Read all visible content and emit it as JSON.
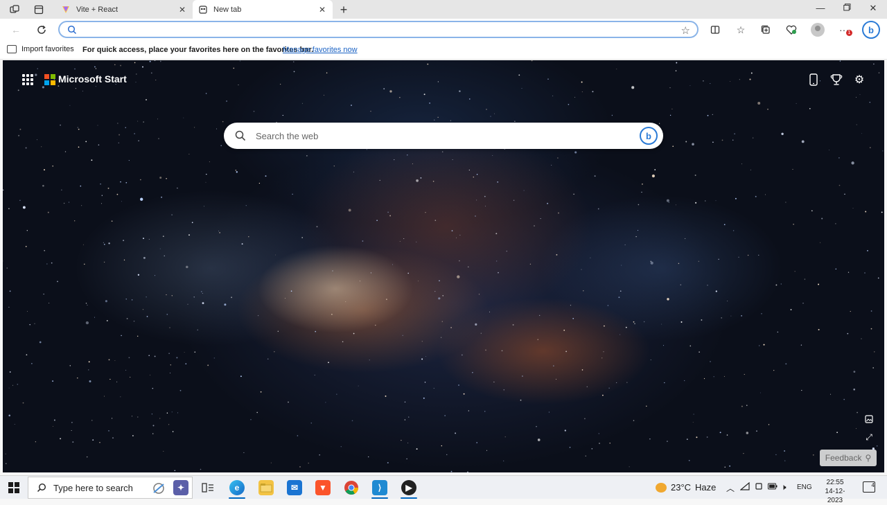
{
  "browser": {
    "tabs": [
      {
        "title": "Vite + React",
        "favicon": "vite-icon",
        "active": false
      },
      {
        "title": "New tab",
        "favicon": "newtab-icon",
        "active": true
      }
    ],
    "new_tab_label": "+",
    "address": {
      "value": "",
      "placeholder": ""
    },
    "notification_count": "1"
  },
  "favorites_bar": {
    "import_label": "Import favorites",
    "message": "For quick access, place your favorites here on the favorites bar.",
    "manage_link": "Manage favorites now"
  },
  "new_tab_page": {
    "brand": "Microsoft Start",
    "search_placeholder": "Search the web",
    "feedback_label": "Feedback",
    "logo_colors": [
      "#f25022",
      "#7fba00",
      "#00a4ef",
      "#ffb900"
    ]
  },
  "taskbar": {
    "search_placeholder": "Type here to search",
    "weather": {
      "temp": "23°C",
      "condition": "Haze"
    },
    "language": "ENG",
    "time": "22:55",
    "date": "14-12-2023",
    "notification_count": "4"
  }
}
